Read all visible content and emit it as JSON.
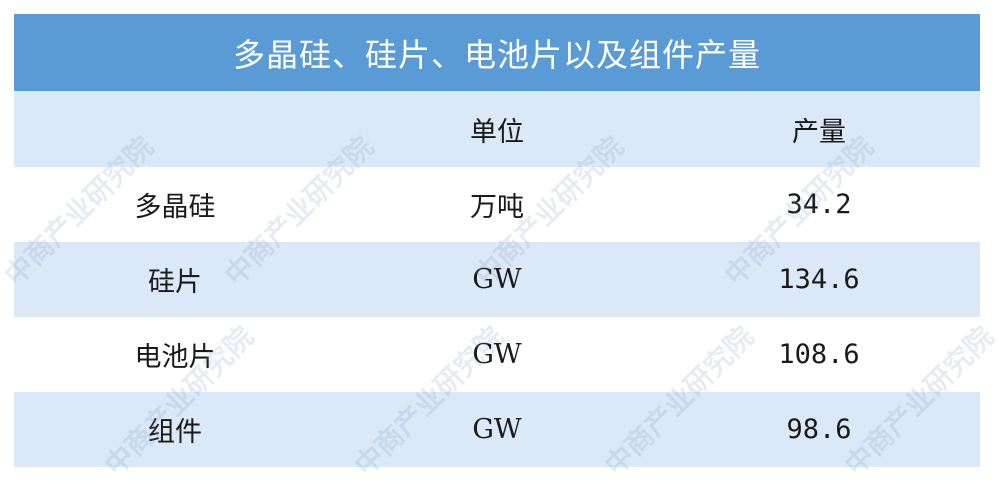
{
  "title": "多晶硅、硅片、电池片以及组件产量",
  "header": {
    "col1": "",
    "col2": "单位",
    "col3": "产量"
  },
  "rows": [
    {
      "name": "多晶硅",
      "unit": "万吨",
      "value": "34.2"
    },
    {
      "name": "硅片",
      "unit": "GW",
      "value": "134.6"
    },
    {
      "name": "电池片",
      "unit": "GW",
      "value": "108.6"
    },
    {
      "name": "组件",
      "unit": "GW",
      "value": "98.6"
    }
  ],
  "watermark": {
    "text": "中商产业研究院"
  },
  "colors": {
    "header": "#5b9bd5",
    "stripe": "#dbe8f7"
  }
}
